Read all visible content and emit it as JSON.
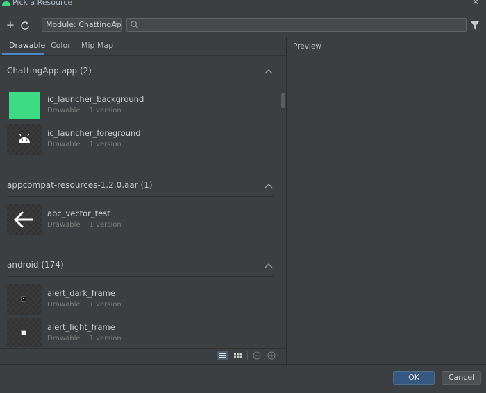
{
  "window": {
    "title": "Pick a Resource"
  },
  "toolbar": {
    "add_label": "+",
    "module_select": "Module: ChattingApp",
    "search_placeholder": ""
  },
  "tabs": [
    {
      "label": "Drawable",
      "active": true
    },
    {
      "label": "Color",
      "active": false
    },
    {
      "label": "Mip Map",
      "active": false
    }
  ],
  "groups": [
    {
      "title": "ChattingApp.app (2)",
      "items": [
        {
          "name": "ic_launcher_background",
          "type": "Drawable",
          "versions": "1 version"
        },
        {
          "name": "ic_launcher_foreground",
          "type": "Drawable",
          "versions": "1 version"
        }
      ]
    },
    {
      "title": "appcompat-resources-1.2.0.aar (1)",
      "items": [
        {
          "name": "abc_vector_test",
          "type": "Drawable",
          "versions": "1 version"
        }
      ]
    },
    {
      "title": "android (174)",
      "items": [
        {
          "name": "alert_dark_frame",
          "type": "Drawable",
          "versions": "1 version"
        },
        {
          "name": "alert_light_frame",
          "type": "Drawable",
          "versions": "1 version"
        }
      ]
    }
  ],
  "preview": {
    "label": "Preview"
  },
  "footer": {
    "ok_label": "OK",
    "cancel_label": "Cancel"
  },
  "colors": {
    "accent": "#4a88c7",
    "launcher_green": "#3ddc84",
    "ok_button": "#365880"
  }
}
